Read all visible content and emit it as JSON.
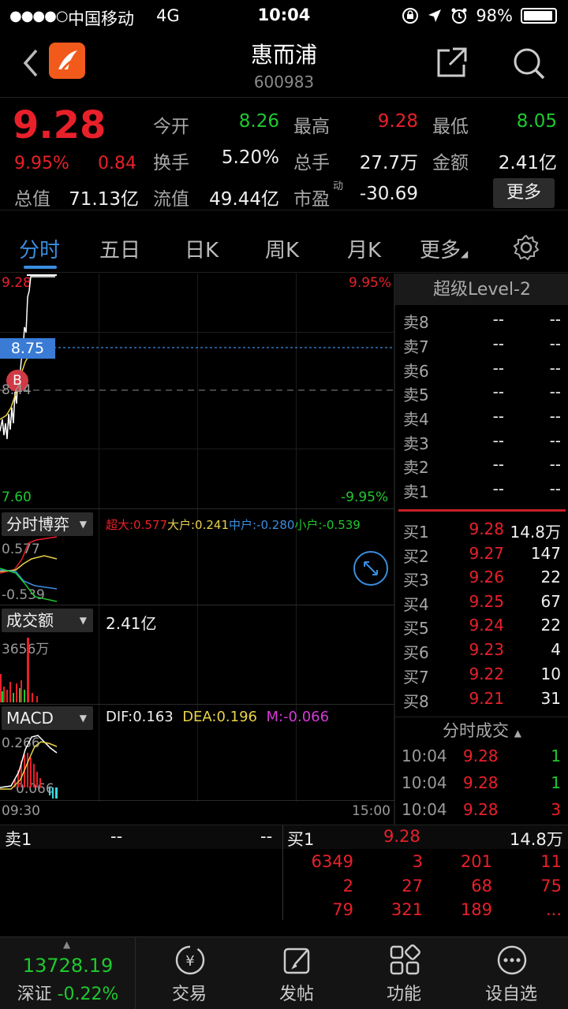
{
  "status_bar": {
    "signal": "●●●●○",
    "carrier": "中国移动",
    "network": "4G",
    "time": "10:04",
    "battery": "98%"
  },
  "nav": {
    "title": "惠而浦",
    "code": "600983"
  },
  "quote": {
    "price": "9.28",
    "change_pct": "9.95%",
    "change_amt": "0.84",
    "open_label": "今开",
    "open": "8.26",
    "high_label": "最高",
    "high": "9.28",
    "low_label": "最低",
    "low": "8.05",
    "turnover_label": "换手",
    "turnover": "5.20%",
    "volume_label": "总手",
    "volume": "27.7万",
    "amount_label": "金额",
    "amount": "2.41亿",
    "mktcap_label": "总值",
    "mktcap": "71.13亿",
    "float_label": "流值",
    "float": "49.44亿",
    "pe_label": "市盈",
    "pe_sup": "动",
    "pe": "-30.69",
    "more_label": "更多"
  },
  "tabs": [
    {
      "label": "分时"
    },
    {
      "label": "五日"
    },
    {
      "label": "日K"
    },
    {
      "label": "周K"
    },
    {
      "label": "月K"
    },
    {
      "label": "更多"
    }
  ],
  "chart": {
    "price_top": "9.28",
    "price_bottom": "7.60",
    "pct_top": "9.95%",
    "pct_bottom": "-9.95%",
    "cursor_price": "8.75",
    "ref_price": "8.44",
    "b_marker": "B",
    "game_label": "分时博弈",
    "game_legend": {
      "big": "超大:0.577",
      "large": "大户:0.241",
      "mid": "中户:-0.280",
      "small": "小户:-0.539"
    },
    "game_top": "0.577",
    "game_bottom": "-0.539",
    "amount_label": "成交额",
    "amount_value": "2.41亿",
    "amount_max": "3656万",
    "macd_label": "MACD",
    "dif": "DIF:0.163",
    "dea": "DEA:0.196",
    "m": "M:-0.066",
    "macd_top": "0.266",
    "macd_bottom": "0.066",
    "time_start": "09:30",
    "time_end": "15:00"
  },
  "order_book": {
    "title": "超级Level-2",
    "asks": [
      {
        "side": "卖8",
        "price": "--",
        "vol": "--"
      },
      {
        "side": "卖7",
        "price": "--",
        "vol": "--"
      },
      {
        "side": "卖6",
        "price": "--",
        "vol": "--"
      },
      {
        "side": "卖5",
        "price": "--",
        "vol": "--"
      },
      {
        "side": "卖4",
        "price": "--",
        "vol": "--"
      },
      {
        "side": "卖3",
        "price": "--",
        "vol": "--"
      },
      {
        "side": "卖2",
        "price": "--",
        "vol": "--"
      },
      {
        "side": "卖1",
        "price": "--",
        "vol": "--"
      }
    ],
    "bids": [
      {
        "side": "买1",
        "price": "9.28",
        "vol": "14.8万"
      },
      {
        "side": "买2",
        "price": "9.27",
        "vol": "147"
      },
      {
        "side": "买3",
        "price": "9.26",
        "vol": "22"
      },
      {
        "side": "买4",
        "price": "9.25",
        "vol": "67"
      },
      {
        "side": "买5",
        "price": "9.24",
        "vol": "22"
      },
      {
        "side": "买6",
        "price": "9.23",
        "vol": "4"
      },
      {
        "side": "买7",
        "price": "9.22",
        "vol": "10"
      },
      {
        "side": "买8",
        "price": "9.21",
        "vol": "31"
      }
    ],
    "trades_title": "分时成交",
    "trades": [
      {
        "time": "10:04",
        "price": "9.28",
        "vol": "1"
      },
      {
        "time": "10:04",
        "price": "9.28",
        "vol": "1"
      },
      {
        "time": "10:04",
        "price": "9.28",
        "vol": "3"
      }
    ]
  },
  "strip": {
    "sell_label": "卖1",
    "sell_price": "--",
    "sell_vol": "--",
    "buy_label": "买1",
    "buy_price": "9.28",
    "buy_vol": "14.8万",
    "queue": [
      [
        "6349",
        "3",
        "201",
        "11"
      ],
      [
        "2",
        "27",
        "68",
        "75"
      ],
      [
        "79",
        "321",
        "189",
        "..."
      ]
    ]
  },
  "tabbar": {
    "index_value": "13728.19",
    "index_name": "深证",
    "index_change": "-0.22%",
    "items": [
      {
        "label": "交易"
      },
      {
        "label": "发帖"
      },
      {
        "label": "功能"
      },
      {
        "label": "设自选"
      }
    ]
  },
  "colors": {
    "up": "#e8202a",
    "down": "#1ec92f",
    "accent": "#3a8de0"
  }
}
